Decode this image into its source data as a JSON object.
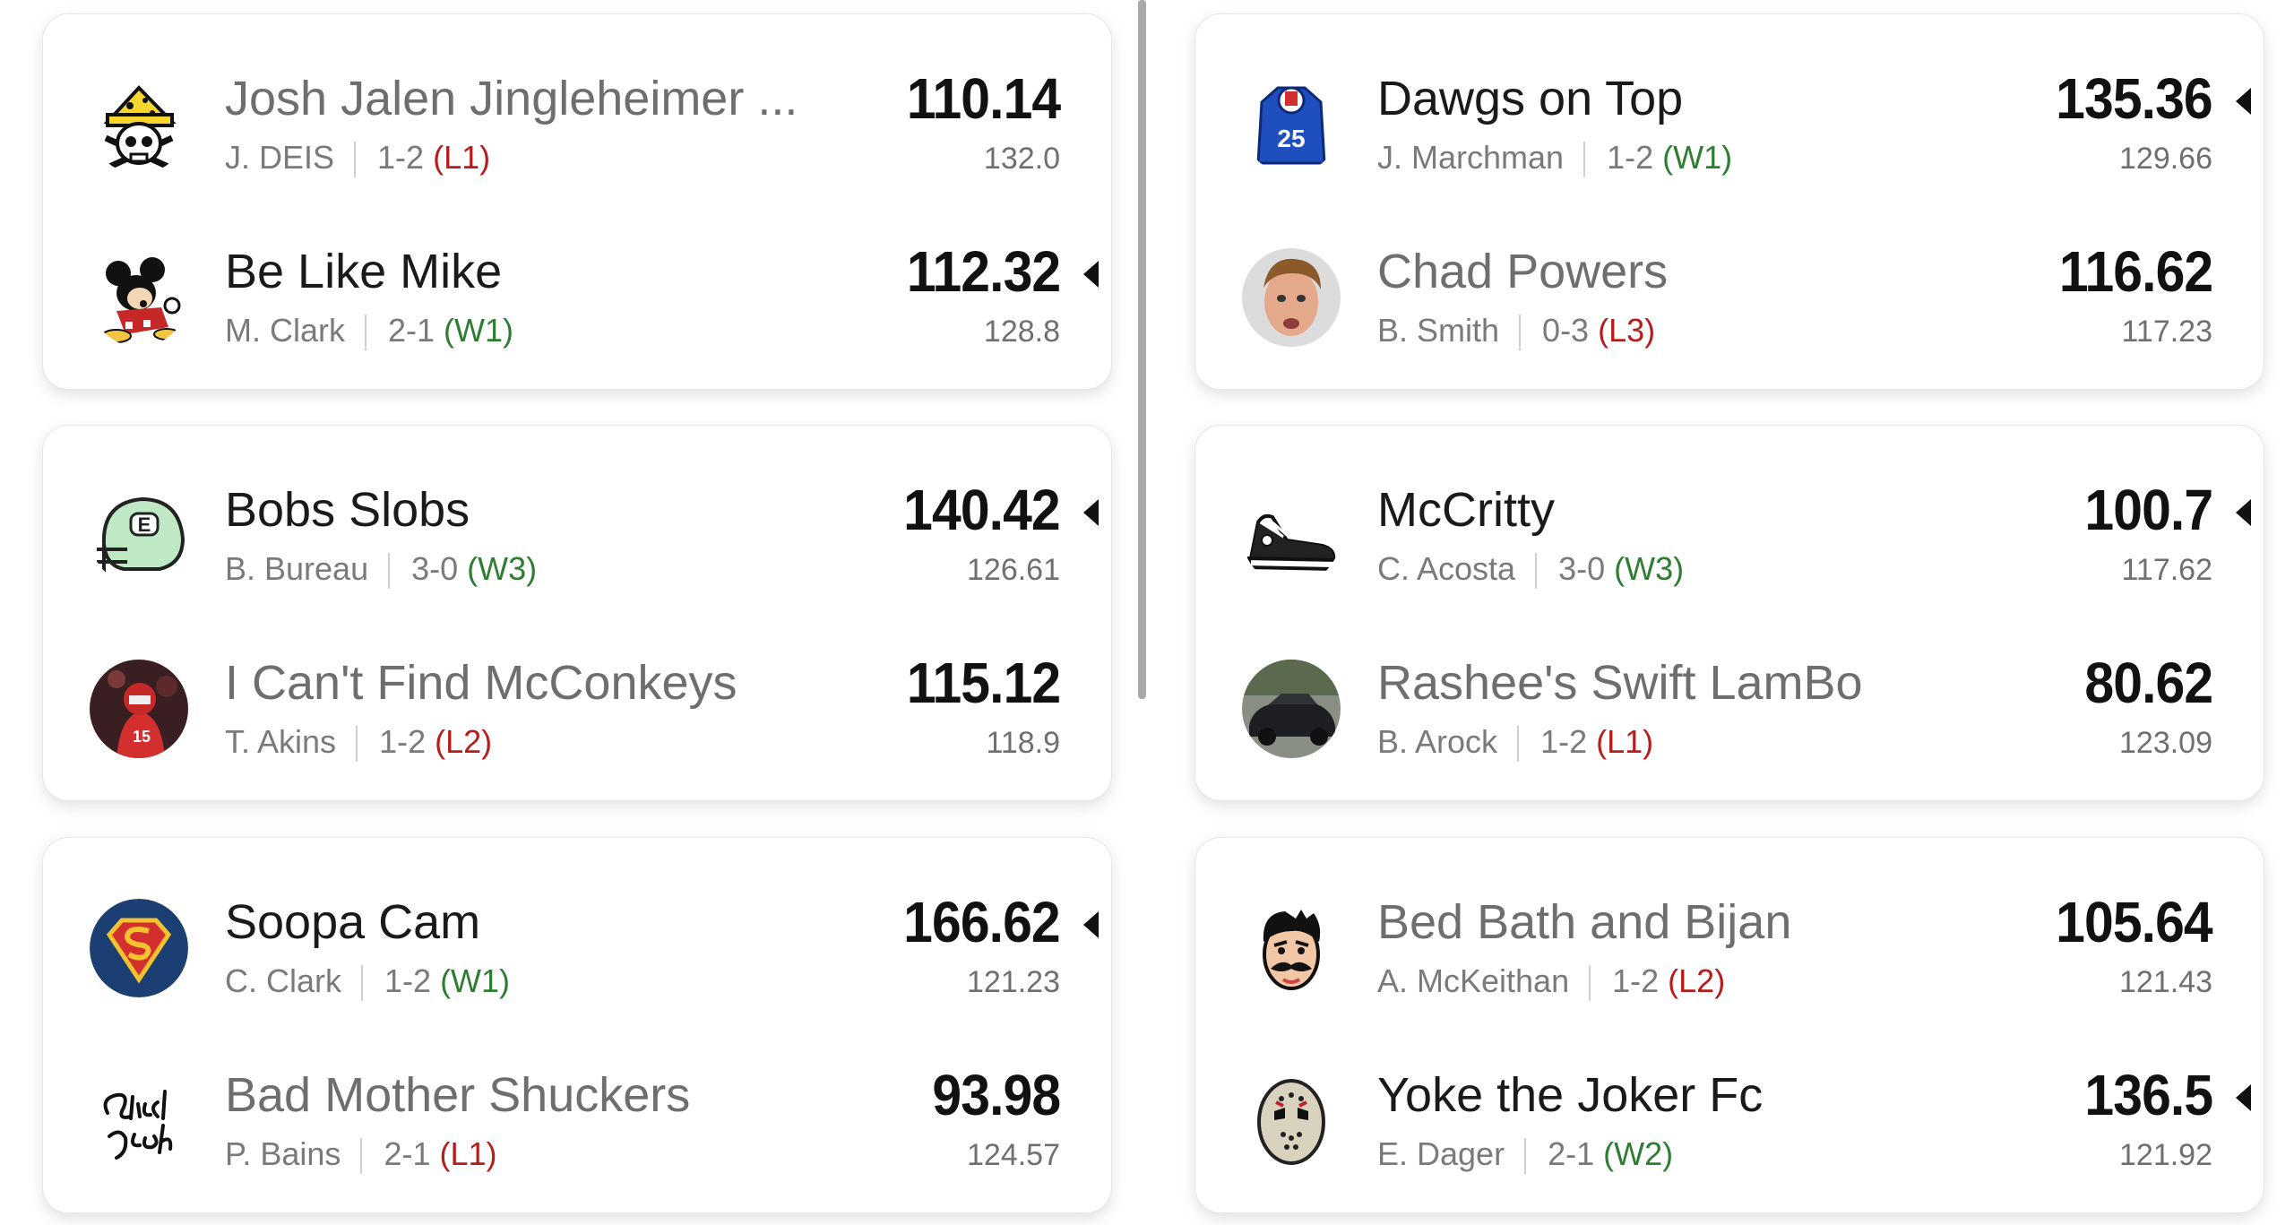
{
  "matchups": [
    {
      "teams": [
        {
          "name": "Josh Jalen Jingleheimer ...",
          "owner": "J. DEIS",
          "record": "1-2",
          "streak": "(L1)",
          "score": "110.14",
          "projected": "132.0",
          "winner": false,
          "logo": "cheese-skull-icon"
        },
        {
          "name": "Be Like Mike",
          "owner": "M. Clark",
          "record": "2-1",
          "streak": "(W1)",
          "score": "112.32",
          "projected": "128.8",
          "winner": true,
          "logo": "cartoon-mouse-icon"
        }
      ]
    },
    {
      "teams": [
        {
          "name": "Dawgs on Top",
          "owner": "J. Marchman",
          "record": "1-2",
          "streak": "(W1)",
          "score": "135.36",
          "projected": "129.66",
          "winner": true,
          "logo": "blue-jersey-icon",
          "jersey_number": "25"
        },
        {
          "name": "Chad Powers",
          "owner": "B. Smith",
          "record": "0-3",
          "streak": "(L3)",
          "score": "116.62",
          "projected": "117.23",
          "winner": false,
          "logo": "player-photo-avatar"
        }
      ]
    },
    {
      "teams": [
        {
          "name": "Bobs Slobs",
          "owner": "B. Bureau",
          "record": "3-0",
          "streak": "(W3)",
          "score": "140.42",
          "projected": "126.61",
          "winner": true,
          "logo": "green-helmet-icon",
          "helmet_letter": "E"
        },
        {
          "name": "I Can't Find McConkeys",
          "owner": "T. Akins",
          "record": "1-2",
          "streak": "(L2)",
          "score": "115.12",
          "projected": "118.9",
          "winner": false,
          "logo": "player-photo-avatar"
        }
      ]
    },
    {
      "teams": [
        {
          "name": "McCritty",
          "owner": "C. Acosta",
          "record": "3-0",
          "streak": "(W3)",
          "score": "100.7",
          "projected": "117.62",
          "winner": true,
          "logo": "sneaker-icon"
        },
        {
          "name": "Rashee's Swift LamBo",
          "owner": "B. Arock",
          "record": "1-2",
          "streak": "(L1)",
          "score": "80.62",
          "projected": "123.09",
          "winner": false,
          "logo": "car-photo-avatar"
        }
      ]
    },
    {
      "teams": [
        {
          "name": "Soopa Cam",
          "owner": "C. Clark",
          "record": "1-2",
          "streak": "(W1)",
          "score": "166.62",
          "projected": "121.23",
          "winner": true,
          "logo": "superman-shield-icon"
        },
        {
          "name": "Bad Mother Shuckers",
          "owner": "P. Bains",
          "record": "2-1",
          "streak": "(L1)",
          "score": "93.98",
          "projected": "124.57",
          "winner": false,
          "logo": "script-lettering-logo"
        }
      ]
    },
    {
      "teams": [
        {
          "name": "Bed Bath and Bijan",
          "owner": "A. McKeithan",
          "record": "1-2",
          "streak": "(L2)",
          "score": "105.64",
          "projected": "121.43",
          "winner": false,
          "logo": "mustache-face-icon"
        },
        {
          "name": "Yoke the Joker Fc",
          "owner": "E. Dager",
          "record": "2-1",
          "streak": "(W2)",
          "score": "136.5",
          "projected": "121.92",
          "winner": true,
          "logo": "hockey-mask-icon"
        }
      ]
    }
  ],
  "colors": {
    "win_streak": "#2e7d32",
    "loss_streak": "#b71c1c",
    "winner_text": "#1a1a1a",
    "loser_text": "#6e6e6e"
  }
}
